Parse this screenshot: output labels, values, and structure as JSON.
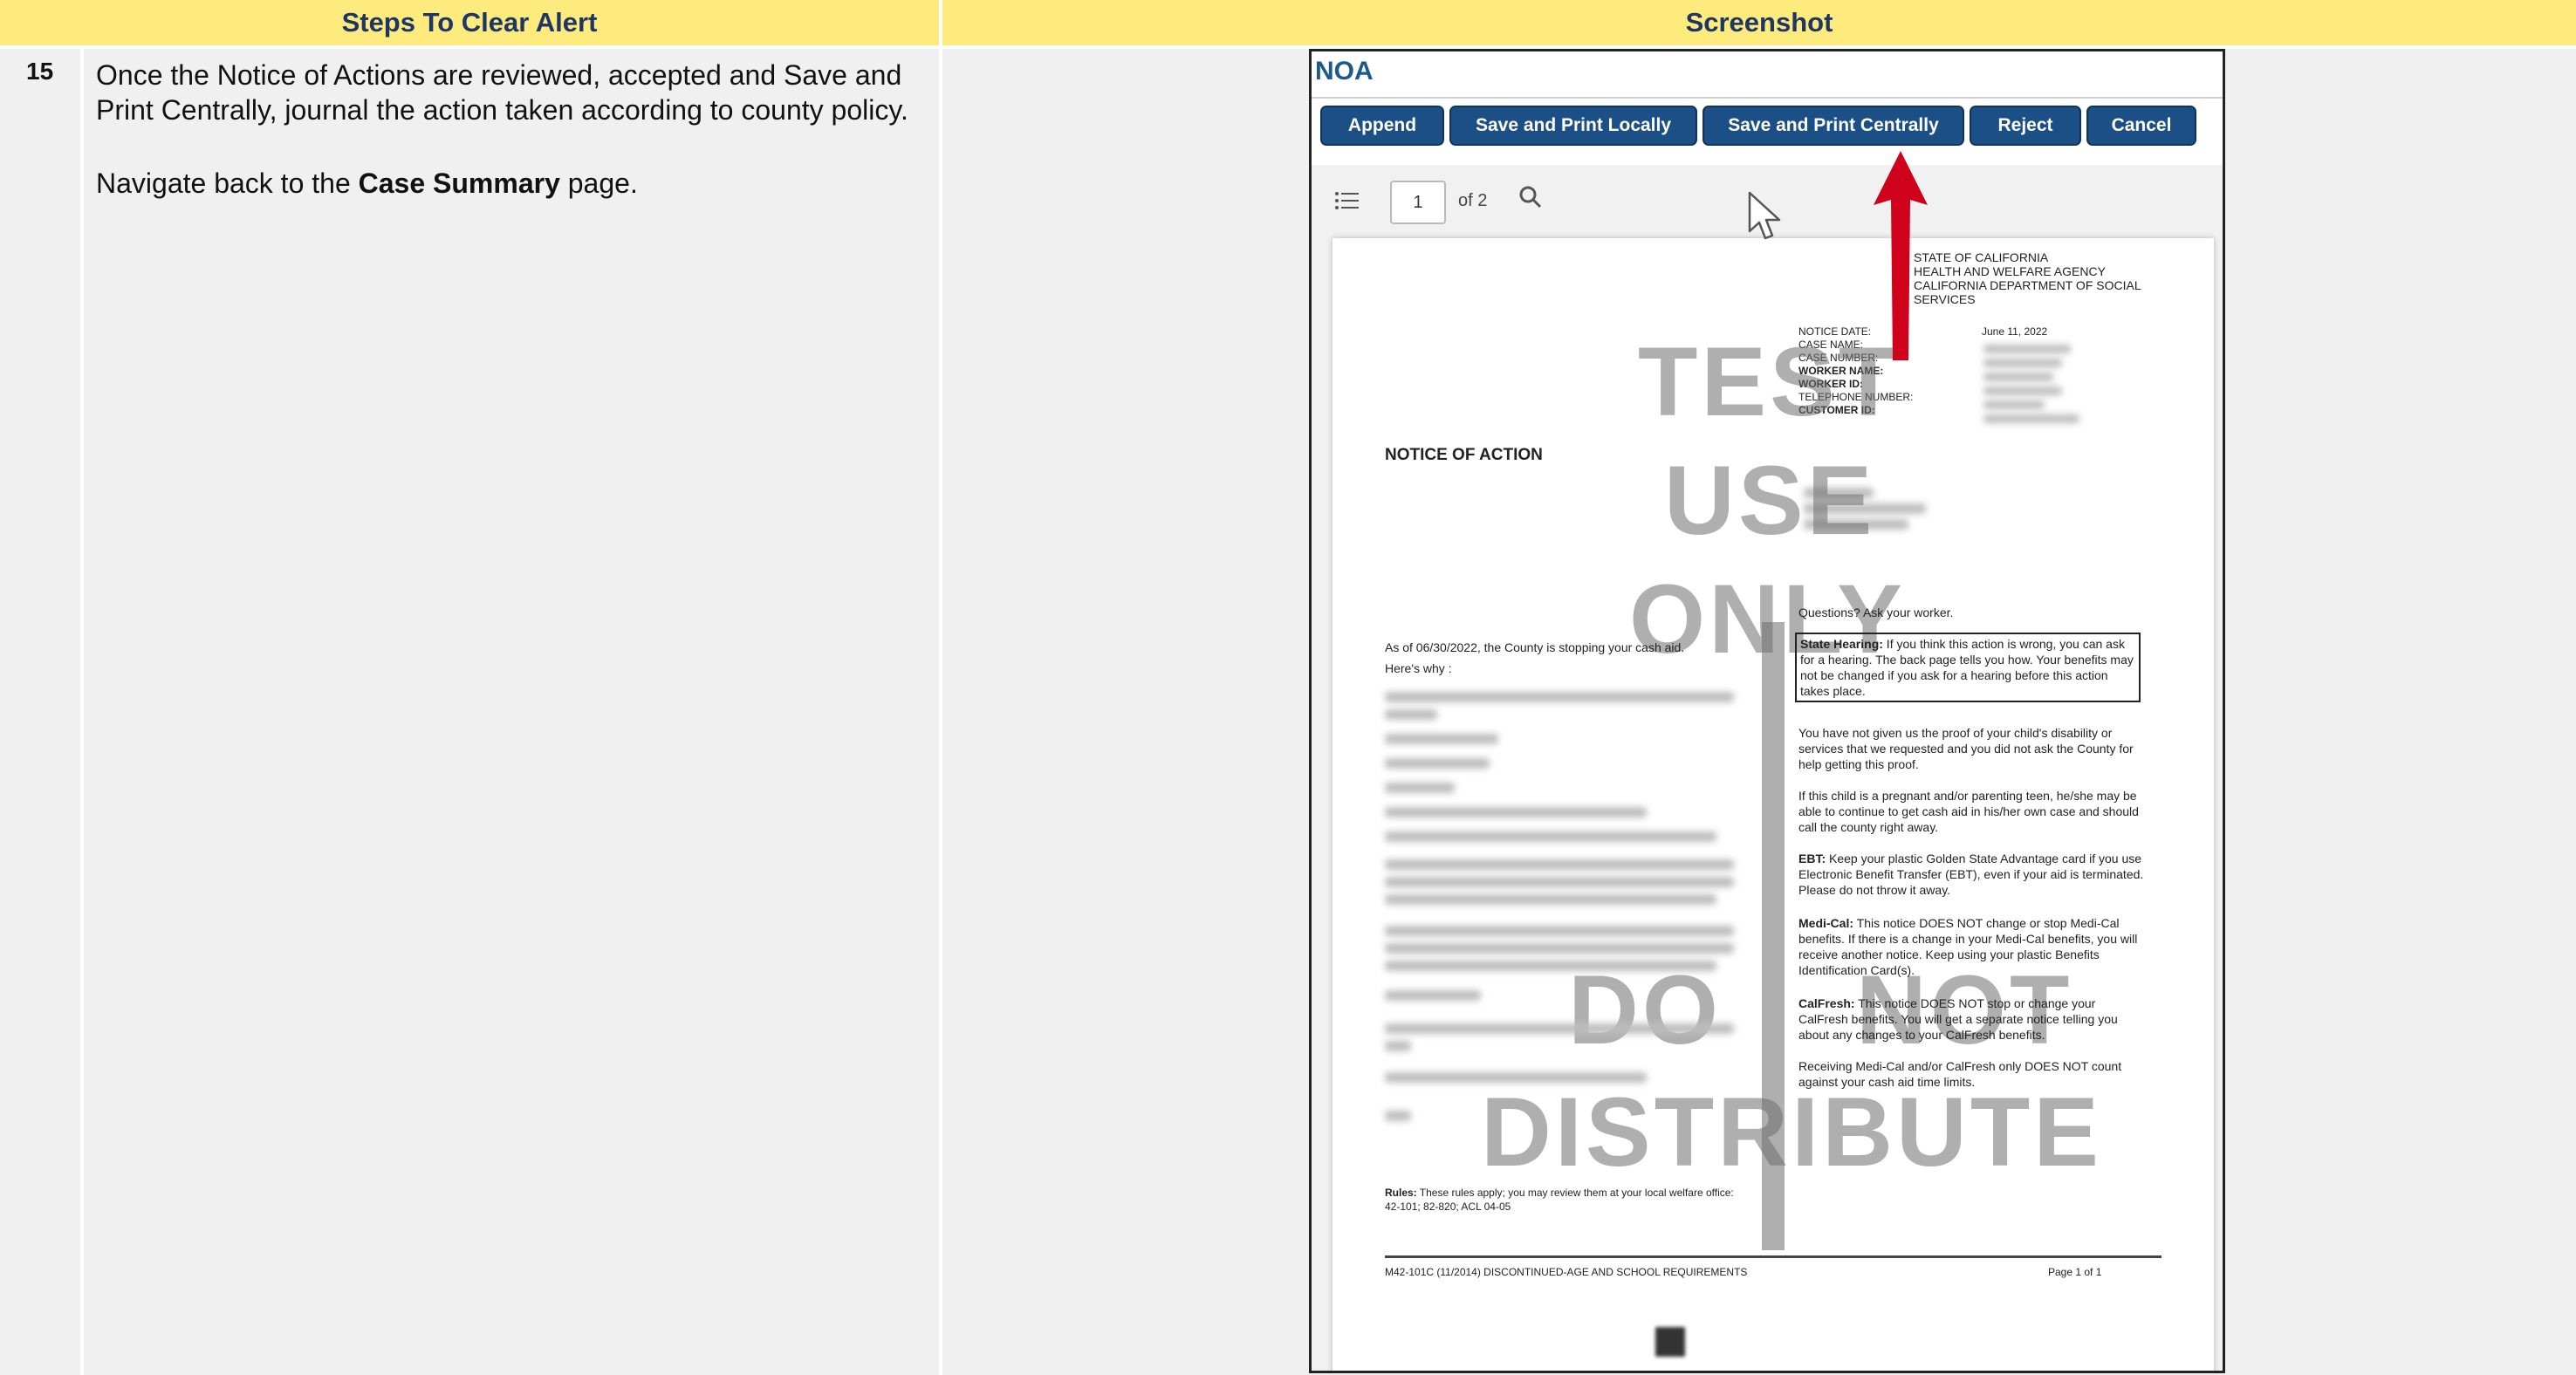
{
  "headers": {
    "steps": "Steps To Clear Alert",
    "screenshot": "Screenshot"
  },
  "step": {
    "number": "15",
    "para1": "Once the Notice of Actions are reviewed, accepted and Save and Print Centrally, journal the action taken according to county policy.",
    "para2_prefix": "Navigate back to the ",
    "para2_bold": "Case Summary",
    "para2_suffix": " page."
  },
  "noa": {
    "title": "NOA",
    "buttons": [
      "Append",
      "Save and Print Locally",
      "Save and Print Centrally",
      "Reject",
      "Cancel"
    ],
    "viewer": {
      "page": "1",
      "of_label": "of 2"
    },
    "doc": {
      "agency": [
        "STATE OF CALIFORNIA",
        "HEALTH AND WELFARE AGENCY",
        "CALIFORNIA DEPARTMENT OF SOCIAL SERVICES"
      ],
      "meta_labels": [
        "NOTICE DATE:",
        "CASE NAME:",
        "CASE NUMBER:",
        "WORKER NAME:",
        "WORKER ID:",
        "TELEPHONE NUMBER:",
        "CUSTOMER ID:"
      ],
      "notice_date": "June 11, 2022",
      "heading": "NOTICE OF ACTION",
      "stopping": "As of 06/30/2022, the County is stopping your cash aid.",
      "heres_why": "Here's why :",
      "questions": "Questions? Ask your worker.",
      "state_hearing_label": "State Hearing:",
      "state_hearing": " If you think this action is wrong, you can ask for a hearing. The back page tells you how. Your benefits may not be changed if you ask for a hearing before this action takes place.",
      "proof": "You have not given us the proof of your child's disability or services that we requested and you did not ask the County for help getting this proof.",
      "pregnant": "If this child is a pregnant and/or parenting teen, he/she may be able to continue to get cash aid in his/her own case and should call the county right away.",
      "ebt_label": "EBT:",
      "ebt": " Keep your plastic Golden State Advantage card if you use Electronic Benefit Transfer (EBT), even if your aid is terminated. Please do not throw it away.",
      "medical_label": "Medi-Cal:",
      "medical": " This notice DOES NOT change or stop Medi-Cal benefits. If there is a change in your Medi-Cal benefits, you will receive another notice. Keep using your plastic Benefits Identification Card(s).",
      "calfresh_label": "CalFresh:",
      "calfresh": " This notice DOES NOT stop or change your CalFresh benefits. You will get a separate notice telling you about any changes to your CalFresh benefits.",
      "receiving": "Receiving Medi-Cal and/or CalFresh only DOES NOT count against your cash aid time limits.",
      "rules_label": "Rules:",
      "rules": " These rules apply; you may review them at your local welfare office: 42-101; 82-820; ACL 04-05",
      "footer_left": "M42-101C (11/2014) DISCONTINUED-AGE AND SCHOOL REQUIREMENTS",
      "footer_right": "Page 1 of 1",
      "stamp_lines": [
        "TEST",
        "USE",
        "ONLY",
        "DO",
        "NOT",
        "DISTRIBUTE"
      ]
    }
  },
  "colors": {
    "header_bg": "#fdeb7e",
    "header_text": "#1f3566",
    "button_bg": "#1c4f86",
    "arrow": "#d0021b"
  }
}
